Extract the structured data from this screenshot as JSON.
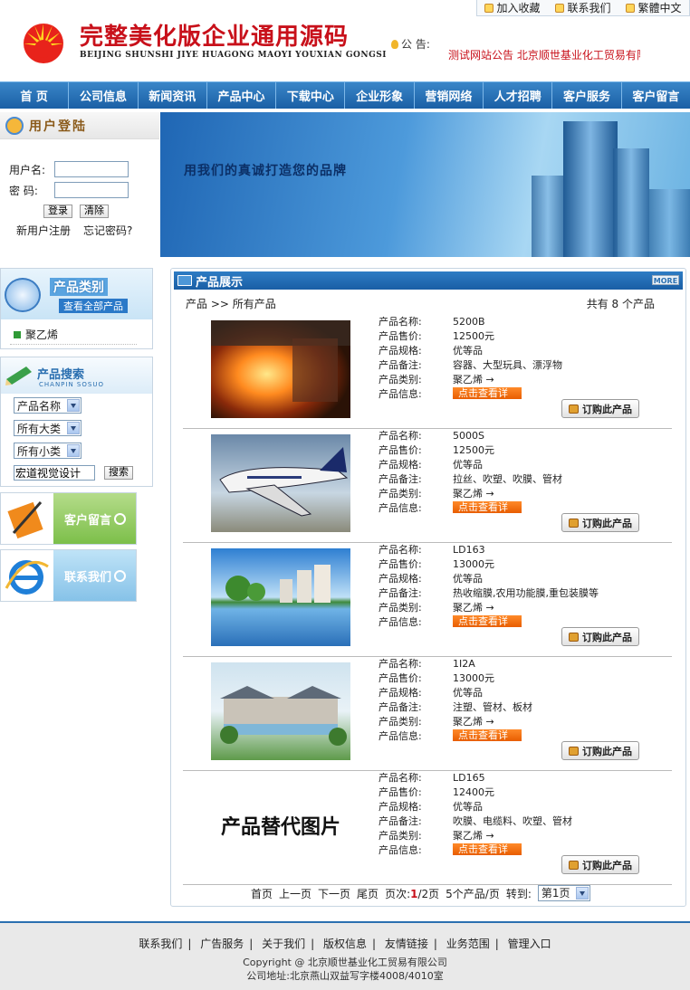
{
  "topbar": {
    "links": [
      "加入收藏",
      "联系我们",
      "繁體中文"
    ]
  },
  "header": {
    "company_cn": "完整美化版企业通用源码",
    "company_en": "BEIJING SHUNSHI JIYE HUAGONG MAOYI YOUXIAN GONGSI",
    "notice_label": "公 告:",
    "notice_text": "测试网站公告 北京顺世基业化工贸易有限公司"
  },
  "nav": [
    "首 页",
    "公司信息",
    "新闻资讯",
    "产品中心",
    "下载中心",
    "企业形象",
    "营销网络",
    "人才招聘",
    "客户服务",
    "客户留言"
  ],
  "login": {
    "title": "用户登陆",
    "username_label": "用户名:",
    "password_label": "密 码:",
    "login_btn": "登录",
    "clear_btn": "清除",
    "register": "新用户注册",
    "forgot": "忘记密码?"
  },
  "banner": {
    "slogan": "用我们的真诚打造您的品牌"
  },
  "category": {
    "title": "产品类别",
    "view_all": "查看全部产品",
    "items": [
      "聚乙烯"
    ]
  },
  "search": {
    "title": "产品搜索",
    "subtitle": "CHANPIN SOSUO",
    "field_select": "产品名称",
    "big_class": "所有大类",
    "small_class": "所有小类",
    "keyword": "宏道视觉设计",
    "search_btn": "搜索"
  },
  "promos": {
    "message": "客户留言",
    "contact": "联系我们"
  },
  "products_panel": {
    "title": "产品展示",
    "more": "MORE",
    "breadcrumb": "产品 >> 所有产品",
    "total": "共有 8 个产品",
    "labels": {
      "name": "产品名称:",
      "price": "产品售价:",
      "spec": "产品规格:",
      "note": "产品备注:",
      "category": "产品类别:",
      "info": "产品信息:"
    },
    "detail_btn": "点击查看详情",
    "order_btn": "订购此产品",
    "items": [
      {
        "name": "5200B",
        "price": "12500元",
        "spec": "优等品",
        "note": "容器、大型玩具、漂浮物",
        "category": "聚乙烯 →",
        "image": "steel-mill"
      },
      {
        "name": "5000S",
        "price": "12500元",
        "spec": "优等品",
        "note": "拉丝、吹塑、吹膜、管材",
        "category": "聚乙烯 →",
        "image": "airplane"
      },
      {
        "name": "LD163",
        "price": "13000元",
        "spec": "优等品",
        "note": "热收缩膜,农用功能膜,重包装膜等",
        "category": "聚乙烯 →",
        "image": "lake-city"
      },
      {
        "name": "1I2A",
        "price": "13000元",
        "spec": "优等品",
        "note": "注塑、管材、板材",
        "category": "聚乙烯 →",
        "image": "resort"
      },
      {
        "name": "LD165",
        "price": "12400元",
        "spec": "优等品",
        "note": "吹膜、电缆料、吹塑、管材",
        "category": "聚乙烯 →",
        "image": "placeholder",
        "placeholder_text": "产品替代图片"
      }
    ],
    "pager": {
      "first": "首页",
      "prev": "上一页",
      "next": "下一页",
      "last": "尾页",
      "page_label": "页次:",
      "current": "1",
      "total_pages": "/2页",
      "per_page": "5个产品/页",
      "goto": "转到:",
      "goto_value": "第1页"
    }
  },
  "footer": {
    "links": [
      "联系我们",
      "广告服务",
      "关于我们",
      "版权信息",
      "友情链接",
      "业务范围",
      "管理入口"
    ],
    "copyright": "Copyright @ 北京顺世基业化工贸易有限公司",
    "address": "公司地址:北京燕山双益写字楼4008/4010室"
  },
  "colors": {
    "brand_red": "#c8101a",
    "nav_blue": "#1a5fa5",
    "detail_orange": "#e85d00"
  }
}
